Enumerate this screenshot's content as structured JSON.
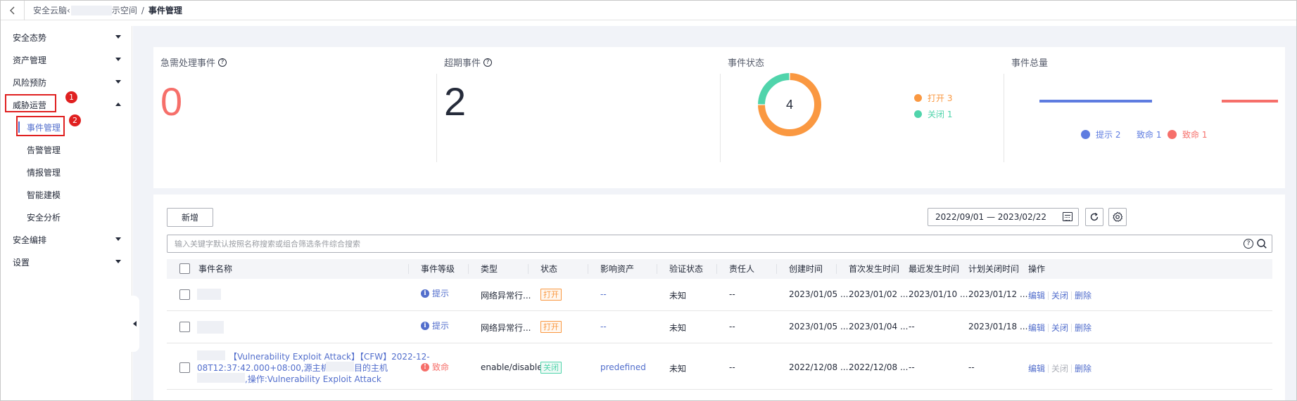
{
  "breadcrumb": {
    "part1": "安全云脑‹",
    "part2": "示空间",
    "current": "事件管理"
  },
  "sidebar": {
    "items": [
      {
        "label": "安全态势"
      },
      {
        "label": "资产管理"
      },
      {
        "label": "风险预防"
      },
      {
        "label": "威胁运营"
      },
      {
        "label": "安全编排"
      },
      {
        "label": "设置"
      }
    ],
    "sub_items": [
      {
        "label": "事件管理"
      },
      {
        "label": "告警管理"
      },
      {
        "label": "情报管理"
      },
      {
        "label": "智能建模"
      },
      {
        "label": "安全分析"
      }
    ],
    "markers": [
      "1",
      "2"
    ],
    "accent_color": "#526ecc",
    "marker_color": "#e02020"
  },
  "stats": {
    "urgent": {
      "title": "急需处理事件",
      "value": "0",
      "color": "#f66f6a"
    },
    "overdue": {
      "title": "超期事件",
      "value": "2"
    },
    "status": {
      "title": "事件状态",
      "total": "4",
      "slices": [
        {
          "label": "打开 3",
          "value": 3,
          "color": "#fa9841"
        },
        {
          "label": "关闭 1",
          "value": 1,
          "color": "#50d4ab"
        }
      ]
    },
    "total": {
      "title": "事件总量",
      "legend": [
        {
          "label": "提示 2",
          "value": 2,
          "color": "#5e7ce0"
        },
        {
          "label": "致命 1",
          "value": 1,
          "color": "#f66f6a"
        }
      ],
      "tooltip_text": "致命 1"
    }
  },
  "toolbar": {
    "new_label": "新增",
    "date_range": "2022/09/01 — 2023/02/22",
    "refresh_icon": "refresh-icon",
    "settings_icon": "gear-icon"
  },
  "search": {
    "placeholder": "输入关键字默认按照名称搜索或组合筛选条件综合搜索",
    "help_glyph": "?"
  },
  "table": {
    "columns": [
      "事件名称",
      "事件等级",
      "类型",
      "状态",
      "影响资产",
      "验证状态",
      "责任人",
      "创建时间",
      "首次发生时间",
      "最近发生时间",
      "计划关闭时间",
      "操作"
    ],
    "rows": [
      {
        "name": "",
        "level": "提示",
        "level_glyph": "i",
        "type": "网络异常行...",
        "status": "打开",
        "asset": "--",
        "verify": "未知",
        "owner": "--",
        "created": "2023/01/05 ...",
        "first": "2023/01/02 ...",
        "last": "2023/01/10 ...",
        "plan_close": "2023/01/12 ...",
        "ops": [
          "编辑",
          "关闭",
          "删除"
        ]
      },
      {
        "name": "",
        "level": "提示",
        "level_glyph": "i",
        "type": "网络异常行...",
        "status": "打开",
        "asset": "--",
        "verify": "未知",
        "owner": "--",
        "created": "2023/01/05 ...",
        "first": "2023/01/04 ...",
        "last": "--",
        "plan_close": "2023/01/18 ...",
        "ops": [
          "编辑",
          "关闭",
          "删除"
        ]
      },
      {
        "name_line1": "【Vulnerability Exploit Attack】【CFW】2022-12-",
        "name_line2a": "08T12:37:42.000+08:00,源主机:",
        "name_line2b": "目的主机",
        "name_line3": ",操作:Vulnerability Exploit Attack",
        "level": "致命",
        "level_glyph": "!",
        "type": "enable/disable",
        "status": "关闭",
        "asset": "predefined",
        "verify": "未知",
        "owner": "--",
        "created": "2022/12/08 ...",
        "first": "2022/12/08 ...",
        "last": "--",
        "plan_close": "--",
        "ops": [
          "编辑",
          "关闭",
          "删除"
        ]
      }
    ]
  }
}
